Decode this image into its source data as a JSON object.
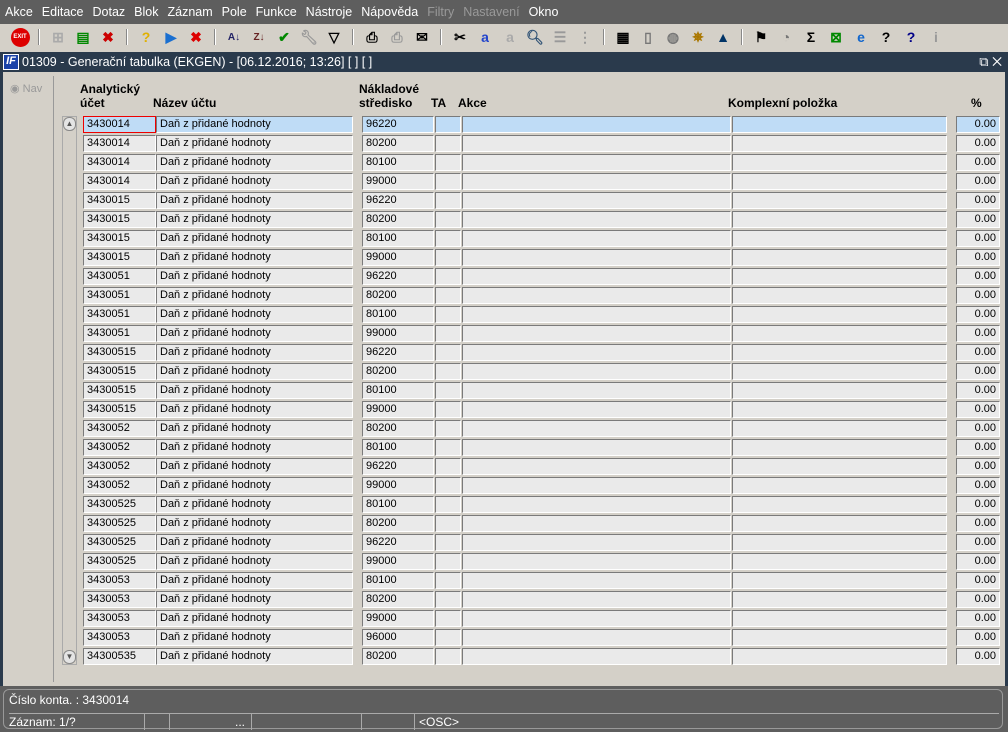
{
  "menu": [
    {
      "label": "Akce"
    },
    {
      "label": "Editace"
    },
    {
      "label": "Dotaz"
    },
    {
      "label": "Blok"
    },
    {
      "label": "Záznam"
    },
    {
      "label": "Pole"
    },
    {
      "label": "Funkce"
    },
    {
      "label": "Nástroje"
    },
    {
      "label": "Nápověda"
    },
    {
      "label": "Filtry",
      "disabled": true
    },
    {
      "label": "Nastavení",
      "disabled": true
    },
    {
      "label": "Okno"
    }
  ],
  "toolbar": {
    "exit_label": "EXIT"
  },
  "window": {
    "logo": "IF",
    "title": "01309 - Generační tabulka (EKGEN) - [06.12.2016; 13:26]  [ ]  [ ]",
    "controls": "⧉ ✕"
  },
  "nav": {
    "label": "Nav"
  },
  "headers": {
    "account_1": "Analytický",
    "account_2": "účet",
    "name": "Název účtu",
    "center_1": "Nákladové",
    "center_2": "středisko",
    "ta": "TA",
    "action": "Akce",
    "complex": "Komplexní položka",
    "percent": "%"
  },
  "rows": [
    [
      "3430014",
      "Daň z přidané hodnoty",
      "96220",
      "0.00"
    ],
    [
      "3430014",
      "Daň z přidané hodnoty",
      "80200",
      "0.00"
    ],
    [
      "3430014",
      "Daň z přidané hodnoty",
      "80100",
      "0.00"
    ],
    [
      "3430014",
      "Daň z přidané hodnoty",
      "99000",
      "0.00"
    ],
    [
      "3430015",
      "Daň z přidané hodnoty",
      "96220",
      "0.00"
    ],
    [
      "3430015",
      "Daň z přidané hodnoty",
      "80200",
      "0.00"
    ],
    [
      "3430015",
      "Daň z přidané hodnoty",
      "80100",
      "0.00"
    ],
    [
      "3430015",
      "Daň z přidané hodnoty",
      "99000",
      "0.00"
    ],
    [
      "3430051",
      "Daň z přidané hodnoty",
      "96220",
      "0.00"
    ],
    [
      "3430051",
      "Daň z přidané hodnoty",
      "80200",
      "0.00"
    ],
    [
      "3430051",
      "Daň z přidané hodnoty",
      "80100",
      "0.00"
    ],
    [
      "3430051",
      "Daň z přidané hodnoty",
      "99000",
      "0.00"
    ],
    [
      "34300515",
      "Daň z přidané hodnoty",
      "96220",
      "0.00"
    ],
    [
      "34300515",
      "Daň z přidané hodnoty",
      "80200",
      "0.00"
    ],
    [
      "34300515",
      "Daň z přidané hodnoty",
      "80100",
      "0.00"
    ],
    [
      "34300515",
      "Daň z přidané hodnoty",
      "99000",
      "0.00"
    ],
    [
      "3430052",
      "Daň z přidané hodnoty",
      "80200",
      "0.00"
    ],
    [
      "3430052",
      "Daň z přidané hodnoty",
      "80100",
      "0.00"
    ],
    [
      "3430052",
      "Daň z přidané hodnoty",
      "96220",
      "0.00"
    ],
    [
      "3430052",
      "Daň z přidané hodnoty",
      "99000",
      "0.00"
    ],
    [
      "34300525",
      "Daň z přidané hodnoty",
      "80100",
      "0.00"
    ],
    [
      "34300525",
      "Daň z přidané hodnoty",
      "80200",
      "0.00"
    ],
    [
      "34300525",
      "Daň z přidané hodnoty",
      "96220",
      "0.00"
    ],
    [
      "34300525",
      "Daň z přidané hodnoty",
      "99000",
      "0.00"
    ],
    [
      "3430053",
      "Daň z přidané hodnoty",
      "80100",
      "0.00"
    ],
    [
      "3430053",
      "Daň z přidané hodnoty",
      "80200",
      "0.00"
    ],
    [
      "3430053",
      "Daň z přidané hodnoty",
      "99000",
      "0.00"
    ],
    [
      "3430053",
      "Daň z přidané hodnoty",
      "96000",
      "0.00"
    ],
    [
      "34300535",
      "Daň z přidané hodnoty",
      "80200",
      "0.00"
    ]
  ],
  "status": {
    "line1": "Číslo konta. : 3430014",
    "record": "Záznam: 1/?",
    "ellipsis": "...",
    "mode": "<OSC>"
  }
}
